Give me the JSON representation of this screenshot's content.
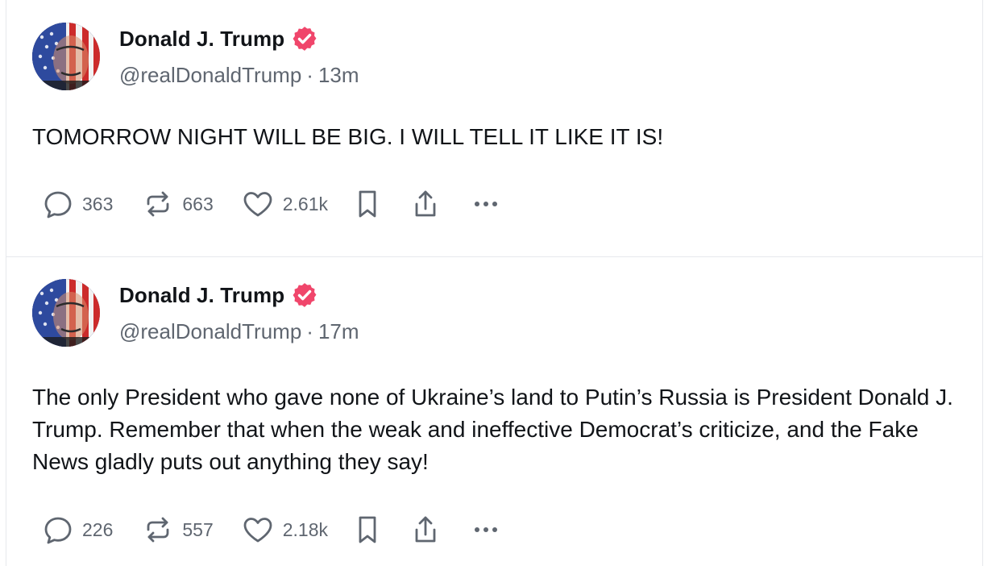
{
  "posts": [
    {
      "author": {
        "name": "Donald J. Trump",
        "handle": "@realDonaldTrump",
        "time": "13m"
      },
      "separator": "·",
      "text": "TOMORROW NIGHT WILL BE BIG. I WILL TELL IT LIKE IT IS!",
      "stats": {
        "replies": "363",
        "reposts": "663",
        "likes": "2.61k"
      }
    },
    {
      "author": {
        "name": "Donald J. Trump",
        "handle": "@realDonaldTrump",
        "time": "17m"
      },
      "separator": "·",
      "text": "The only President who gave none of Ukraine’s land to Putin’s Russia is President Donald J. Trump. Remember that when the weak and ineffective Democrat’s criticize, and the Fake News gladly puts out anything they say!",
      "stats": {
        "replies": "226",
        "reposts": "557",
        "likes": "2.18k"
      }
    }
  ],
  "icons": {
    "verified": "verified-badge-icon",
    "reply": "speech-bubble-icon",
    "repost": "repost-arrows-icon",
    "like": "heart-icon",
    "bookmark": "bookmark-icon",
    "share": "share-upload-icon",
    "more": "more-dots-icon"
  },
  "colors": {
    "verified_badge": "#f0466b",
    "muted_text": "#5f6670",
    "divider": "#e6e8ec"
  }
}
